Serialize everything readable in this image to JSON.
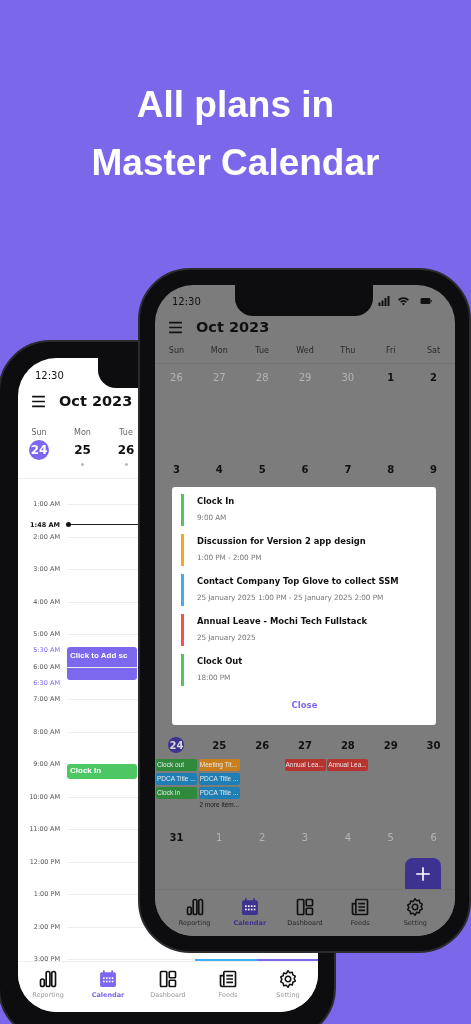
{
  "headline": {
    "lines": [
      "All plans in",
      "Master Calendar"
    ]
  },
  "back_phone": {
    "status_time": "12:30",
    "title": "Oct 2023",
    "days": [
      {
        "weekday": "Sun",
        "date": "24",
        "selected": true,
        "has_events": false
      },
      {
        "weekday": "Mon",
        "date": "25",
        "selected": false,
        "has_events": true
      },
      {
        "weekday": "Tue",
        "date": "26",
        "selected": false,
        "has_events": true
      }
    ],
    "timeline": [
      {
        "label": "1:00 AM",
        "kind": "hour"
      },
      {
        "label": "1:48 AM",
        "kind": "now"
      },
      {
        "label": "2:00 AM",
        "kind": "hour"
      },
      {
        "label": "3:00 AM",
        "kind": "hour"
      },
      {
        "label": "4:00 AM",
        "kind": "hour"
      },
      {
        "label": "5:00 AM",
        "kind": "hour"
      },
      {
        "label": "5:30 AM",
        "kind": "half",
        "events": [
          {
            "kind": "add",
            "title": "Click to Add sc",
            "color": "#7b68ee"
          }
        ]
      },
      {
        "label": "6:00 AM",
        "kind": "hour"
      },
      {
        "label": "6:30 AM",
        "kind": "half"
      },
      {
        "label": "7:00 AM",
        "kind": "hour"
      },
      {
        "label": "8:00 AM",
        "kind": "hour"
      },
      {
        "label": "9:00 AM",
        "kind": "hour",
        "events": [
          {
            "kind": "event",
            "title": "Clock In",
            "color": "#4cc764"
          }
        ]
      },
      {
        "label": "10:00 AM",
        "kind": "hour"
      },
      {
        "label": "11:00 AM",
        "kind": "hour"
      },
      {
        "label": "12:00 PM",
        "kind": "hour"
      },
      {
        "label": "1:00 PM",
        "kind": "hour"
      },
      {
        "label": "2:00 PM",
        "kind": "hour"
      },
      {
        "label": "3:00 PM",
        "kind": "hour",
        "events": [
          {
            "kind": "bar",
            "color": "#3bb0f0"
          },
          {
            "kind": "bar",
            "color": "#7b68ee"
          }
        ]
      }
    ],
    "nav": [
      {
        "label": "Reporting",
        "selected": false
      },
      {
        "label": "Calendar",
        "selected": true
      },
      {
        "label": "Dashboard",
        "selected": false
      },
      {
        "label": "Feeds",
        "selected": false
      },
      {
        "label": "Setting",
        "selected": false
      }
    ]
  },
  "front_phone": {
    "status_time": "12:30",
    "title": "Oct 2023",
    "weekdays": [
      "Sun",
      "Mon",
      "Tue",
      "Wed",
      "Thu",
      "Fri",
      "Sat"
    ],
    "weeks": [
      {
        "days": [
          {
            "date": "26",
            "in_month": false,
            "selected": false
          },
          {
            "date": "27",
            "in_month": false,
            "selected": false
          },
          {
            "date": "28",
            "in_month": false,
            "selected": false
          },
          {
            "date": "29",
            "in_month": false,
            "selected": false
          },
          {
            "date": "30",
            "in_month": false,
            "selected": false
          },
          {
            "date": "1",
            "in_month": true,
            "selected": false
          },
          {
            "date": "2",
            "in_month": true,
            "selected": false
          }
        ]
      },
      {
        "days": [
          {
            "date": "3",
            "in_month": true,
            "selected": false
          },
          {
            "date": "4",
            "in_month": true,
            "selected": false
          },
          {
            "date": "5",
            "in_month": true,
            "selected": false
          },
          {
            "date": "6",
            "in_month": true,
            "selected": false
          },
          {
            "date": "7",
            "in_month": true,
            "selected": false
          },
          {
            "date": "8",
            "in_month": true,
            "selected": false
          },
          {
            "date": "9",
            "in_month": true,
            "selected": false
          }
        ]
      },
      {
        "days": [
          {
            "date": "24",
            "in_month": true,
            "selected": true,
            "events": [
              {
                "title": "Clock out",
                "color": "#2f8a3c"
              },
              {
                "title": "PDCA Title ...",
                "color": "#1f7fb4"
              },
              {
                "title": "Clock in",
                "color": "#2f8a3c"
              }
            ]
          },
          {
            "date": "25",
            "in_month": true,
            "selected": false,
            "events": [
              {
                "title": "Meeting Tit...",
                "color": "#c9801c"
              },
              {
                "title": "PDCA Title ...",
                "color": "#1f7fb4"
              },
              {
                "title": "PDCA Title ...",
                "color": "#1f7fb4"
              }
            ],
            "more": "2 more item..."
          },
          {
            "date": "26",
            "in_month": true,
            "selected": false
          },
          {
            "date": "27",
            "in_month": true,
            "selected": false,
            "events": [
              {
                "title": "Annual Lea...",
                "color": "#b8322e"
              }
            ]
          },
          {
            "date": "28",
            "in_month": true,
            "selected": false,
            "events": [
              {
                "title": "Annual Lea...",
                "color": "#b8322e"
              }
            ]
          },
          {
            "date": "29",
            "in_month": true,
            "selected": false
          },
          {
            "date": "30",
            "in_month": true,
            "selected": false
          }
        ]
      },
      {
        "days": [
          {
            "date": "31",
            "in_month": true,
            "selected": false
          },
          {
            "date": "1",
            "in_month": false,
            "selected": false
          },
          {
            "date": "2",
            "in_month": false,
            "selected": false
          },
          {
            "date": "3",
            "in_month": false,
            "selected": false
          },
          {
            "date": "4",
            "in_month": false,
            "selected": false
          },
          {
            "date": "5",
            "in_month": false,
            "selected": false
          },
          {
            "date": "6",
            "in_month": false,
            "selected": false
          }
        ]
      }
    ],
    "dialog": {
      "items": [
        {
          "title": "Clock In",
          "time": "9:00 AM",
          "color": "#4cc764"
        },
        {
          "title": "Discussion for Version 2 app design",
          "time": "1:00 PM - 2:00 PM",
          "color": "#f5a623"
        },
        {
          "title": "Contact Company Top Glove to collect SSM",
          "time": "25 January 2025 1:00 PM - 25 January 2025 2:00 PM",
          "color": "#3bb0f0"
        },
        {
          "title": "Annual Leave - Mochi Tech Fullstack",
          "time": "25 January 2025",
          "color": "#f0544f"
        },
        {
          "title": "Clock Out",
          "time": "18:00 PM",
          "color": "#4cc764"
        }
      ],
      "close": "Close"
    },
    "nav": [
      {
        "label": "Reporting",
        "selected": false
      },
      {
        "label": "Calendar",
        "selected": true
      },
      {
        "label": "Dashboard",
        "selected": false
      },
      {
        "label": "Feeds",
        "selected": false
      },
      {
        "label": "Setting",
        "selected": false
      }
    ]
  }
}
